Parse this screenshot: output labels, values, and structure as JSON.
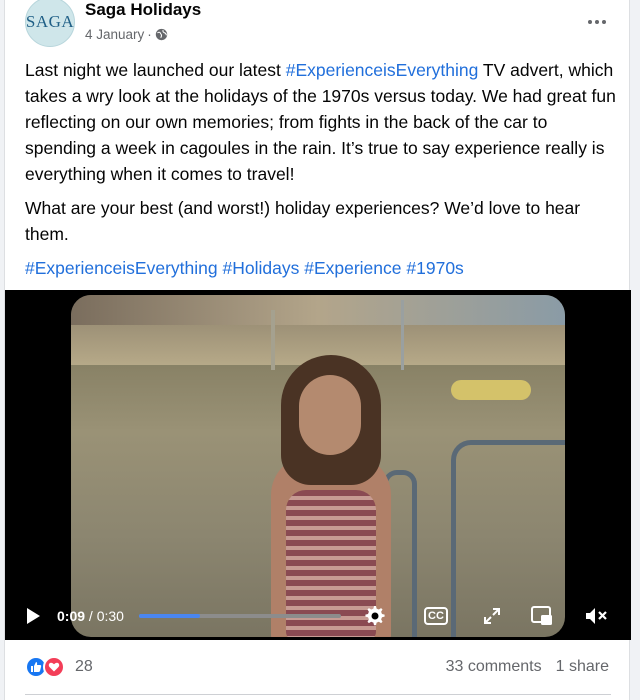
{
  "post": {
    "page_name": "Saga Holidays",
    "avatar_text": "SAGA",
    "date": "4 January",
    "separator": "·",
    "privacy_icon": "globe-icon",
    "paragraph1_before": "Last night we launched our latest ",
    "paragraph1_hashtag": "#ExperienceisEverything",
    "paragraph1_after": " TV advert, which takes a wry look at the holidays of the 1970s versus today. We had great fun reflecting on our own memories; from fights in the back of the car to spending a week in cagoules in the rain. It’s true to say experience really is everything when it comes to travel!",
    "paragraph2": "What are your best (and worst!) holiday experiences? We’d love to hear them.",
    "hashtags": [
      "#ExperienceisEverything",
      "#Holidays",
      "#Experience",
      "#1970s"
    ]
  },
  "video": {
    "current_time": "0:09",
    "duration_sep": " / ",
    "duration": "0:30",
    "progress_fraction": 0.3,
    "cc_label": "CC",
    "icons": [
      "play-icon",
      "settings-icon",
      "captions-icon",
      "fullscreen-icon",
      "picture-in-picture-icon",
      "mute-icon"
    ]
  },
  "footer": {
    "reaction_count": "28",
    "comments": "33 comments",
    "shares": "1 share",
    "reaction_icons": [
      "like-icon",
      "love-icon"
    ]
  },
  "colors": {
    "link": "#216fdb",
    "like": "#1877f2",
    "love": "#f33e58",
    "progress": "#4a86f0",
    "muted_text": "#65676b"
  }
}
